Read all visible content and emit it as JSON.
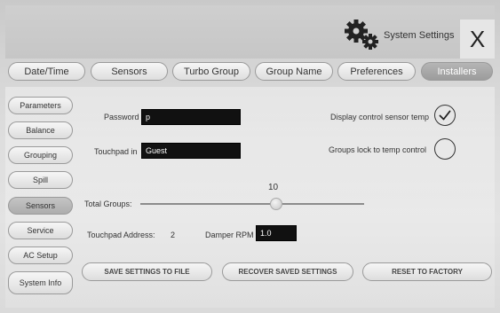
{
  "header": {
    "title": "System Settings",
    "close_label": "X"
  },
  "tabs": [
    {
      "label": "Date/Time"
    },
    {
      "label": "Sensors"
    },
    {
      "label": "Turbo Group"
    },
    {
      "label": "Group Name"
    },
    {
      "label": "Preferences"
    },
    {
      "label": "Installers",
      "active": true
    }
  ],
  "sidebar": {
    "items": [
      {
        "label": "Parameters"
      },
      {
        "label": "Balance"
      },
      {
        "label": "Grouping"
      },
      {
        "label": "Spill"
      },
      {
        "label": "Sensors",
        "active": true
      },
      {
        "label": "Service"
      },
      {
        "label": "AC Setup"
      },
      {
        "label": "System Info"
      }
    ]
  },
  "form": {
    "password_label": "Password",
    "password_value": "p",
    "touchpad_label": "Touchpad in",
    "touchpad_value": "Guest",
    "display_control_label": "Display control sensor temp",
    "display_control_checked": true,
    "groups_lock_label": "Groups lock to temp control",
    "groups_lock_checked": false,
    "total_groups_label": "Total Groups:",
    "total_groups_value": "10",
    "total_groups_level": 0.58,
    "touchpad_address_label": "Touchpad Address:",
    "touchpad_address_value": "2",
    "damper_rpm_label": "Damper RPM",
    "damper_rpm_value": "1.0"
  },
  "actions": {
    "save_label": "SAVE SETTINGS TO FILE",
    "recover_label": "RECOVER SAVED SETTINGS",
    "reset_label": "RESET TO FACTORY"
  },
  "icons": {
    "gears": "gears-icon",
    "close": "close-icon",
    "check": "checkmark-icon"
  }
}
